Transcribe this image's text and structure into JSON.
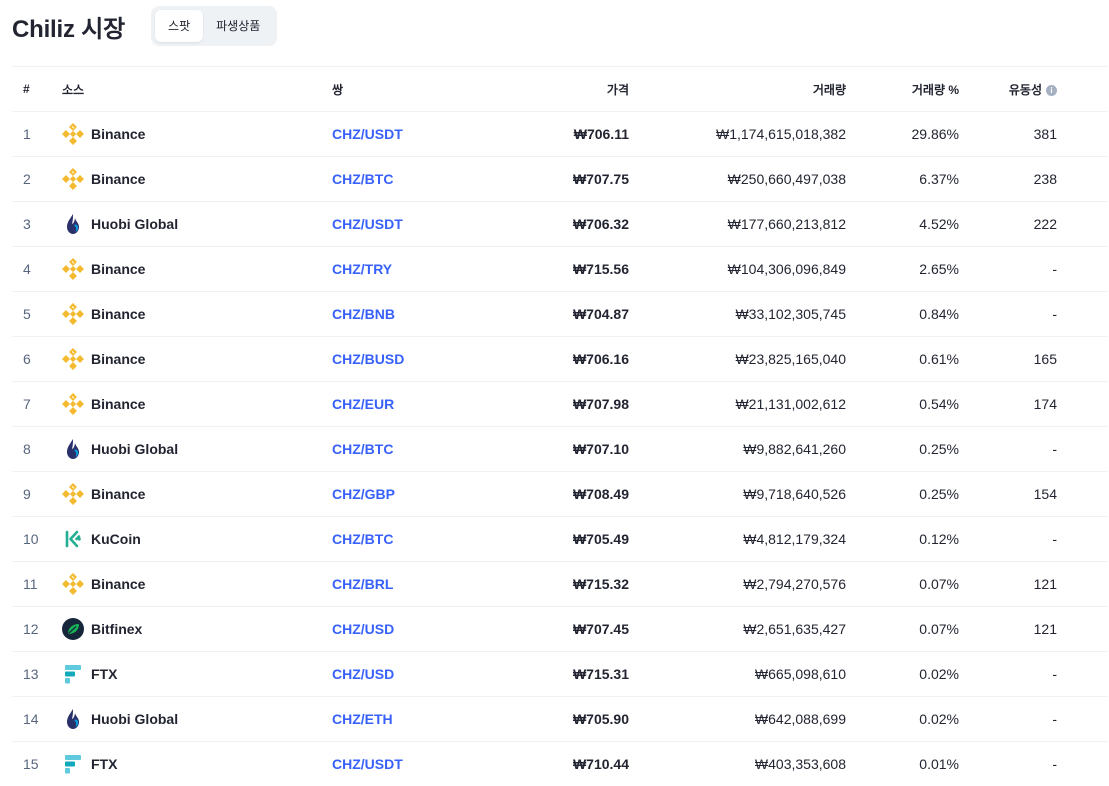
{
  "header": {
    "title": "Chiliz 시장",
    "tabs": [
      {
        "label": "스팟",
        "active": true
      },
      {
        "label": "파생상품",
        "active": false
      }
    ]
  },
  "table": {
    "columns": {
      "rank": "#",
      "source": "소스",
      "pair": "쌍",
      "price": "가격",
      "volume": "거래량",
      "volume_pct": "거래량 %",
      "liquidity": "유동성"
    },
    "rows": [
      {
        "rank": "1",
        "source": "Binance",
        "icon": "binance-icon",
        "pair": "CHZ/USDT",
        "price": "₩706.11",
        "volume": "₩1,174,615,018,382",
        "volume_pct": "29.86%",
        "liquidity": "381"
      },
      {
        "rank": "2",
        "source": "Binance",
        "icon": "binance-icon",
        "pair": "CHZ/BTC",
        "price": "₩707.75",
        "volume": "₩250,660,497,038",
        "volume_pct": "6.37%",
        "liquidity": "238"
      },
      {
        "rank": "3",
        "source": "Huobi Global",
        "icon": "huobi-icon",
        "pair": "CHZ/USDT",
        "price": "₩706.32",
        "volume": "₩177,660,213,812",
        "volume_pct": "4.52%",
        "liquidity": "222"
      },
      {
        "rank": "4",
        "source": "Binance",
        "icon": "binance-icon",
        "pair": "CHZ/TRY",
        "price": "₩715.56",
        "volume": "₩104,306,096,849",
        "volume_pct": "2.65%",
        "liquidity": "-"
      },
      {
        "rank": "5",
        "source": "Binance",
        "icon": "binance-icon",
        "pair": "CHZ/BNB",
        "price": "₩704.87",
        "volume": "₩33,102,305,745",
        "volume_pct": "0.84%",
        "liquidity": "-"
      },
      {
        "rank": "6",
        "source": "Binance",
        "icon": "binance-icon",
        "pair": "CHZ/BUSD",
        "price": "₩706.16",
        "volume": "₩23,825,165,040",
        "volume_pct": "0.61%",
        "liquidity": "165"
      },
      {
        "rank": "7",
        "source": "Binance",
        "icon": "binance-icon",
        "pair": "CHZ/EUR",
        "price": "₩707.98",
        "volume": "₩21,131,002,612",
        "volume_pct": "0.54%",
        "liquidity": "174"
      },
      {
        "rank": "8",
        "source": "Huobi Global",
        "icon": "huobi-icon",
        "pair": "CHZ/BTC",
        "price": "₩707.10",
        "volume": "₩9,882,641,260",
        "volume_pct": "0.25%",
        "liquidity": "-"
      },
      {
        "rank": "9",
        "source": "Binance",
        "icon": "binance-icon",
        "pair": "CHZ/GBP",
        "price": "₩708.49",
        "volume": "₩9,718,640,526",
        "volume_pct": "0.25%",
        "liquidity": "154"
      },
      {
        "rank": "10",
        "source": "KuCoin",
        "icon": "kucoin-icon",
        "pair": "CHZ/BTC",
        "price": "₩705.49",
        "volume": "₩4,812,179,324",
        "volume_pct": "0.12%",
        "liquidity": "-"
      },
      {
        "rank": "11",
        "source": "Binance",
        "icon": "binance-icon",
        "pair": "CHZ/BRL",
        "price": "₩715.32",
        "volume": "₩2,794,270,576",
        "volume_pct": "0.07%",
        "liquidity": "121"
      },
      {
        "rank": "12",
        "source": "Bitfinex",
        "icon": "bitfinex-icon",
        "pair": "CHZ/USD",
        "price": "₩707.45",
        "volume": "₩2,651,635,427",
        "volume_pct": "0.07%",
        "liquidity": "121"
      },
      {
        "rank": "13",
        "source": "FTX",
        "icon": "ftx-icon",
        "pair": "CHZ/USD",
        "price": "₩715.31",
        "volume": "₩665,098,610",
        "volume_pct": "0.02%",
        "liquidity": "-"
      },
      {
        "rank": "14",
        "source": "Huobi Global",
        "icon": "huobi-icon",
        "pair": "CHZ/ETH",
        "price": "₩705.90",
        "volume": "₩642,088,699",
        "volume_pct": "0.02%",
        "liquidity": "-"
      },
      {
        "rank": "15",
        "source": "FTX",
        "icon": "ftx-icon",
        "pair": "CHZ/USDT",
        "price": "₩710.44",
        "volume": "₩403,353,608",
        "volume_pct": "0.01%",
        "liquidity": "-"
      }
    ]
  },
  "colors": {
    "link": "#3861fb",
    "binance": "#f3ba2f",
    "huobi": "#2a3069",
    "kucoin": "#23af91",
    "bitfinex": "#16b157",
    "ftx": "#5fcade"
  }
}
